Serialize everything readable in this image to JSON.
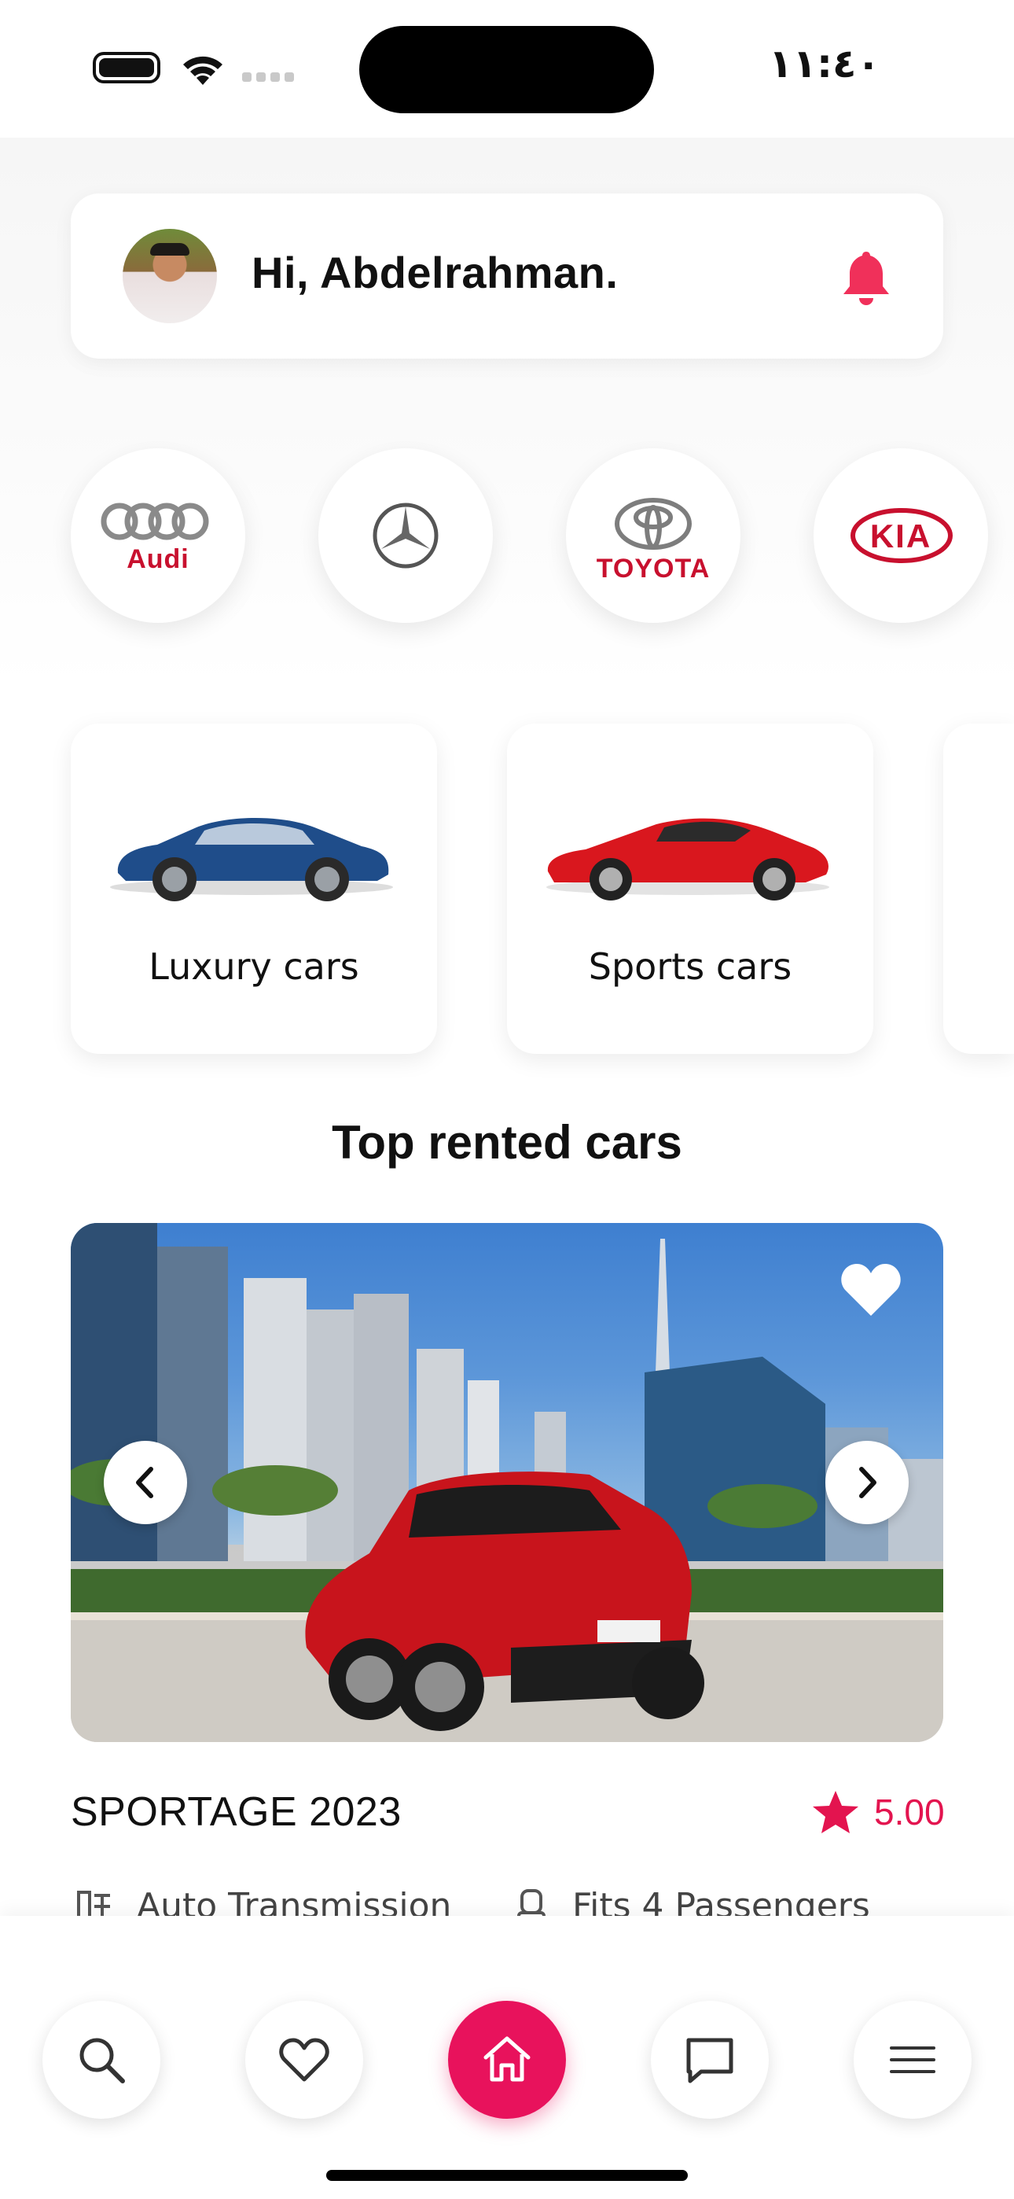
{
  "status_bar": {
    "time": "١١:٤٠"
  },
  "header": {
    "greeting": "Hi, Abdelrahman."
  },
  "brands": [
    {
      "name": "Audi",
      "label": "Audi"
    },
    {
      "name": "Mercedes-Benz",
      "label": ""
    },
    {
      "name": "Toyota",
      "label": "TOYOTA"
    },
    {
      "name": "Kia",
      "label": "KIA"
    }
  ],
  "categories": [
    {
      "label": "Luxury cars"
    },
    {
      "label": "Sports cars"
    }
  ],
  "section": {
    "title": "Top rented cars"
  },
  "featured_car": {
    "name": "SPORTAGE 2023",
    "rating": "5.00",
    "specs": [
      {
        "icon": "gearbox-icon",
        "label": "Auto Transmission"
      },
      {
        "icon": "seat-icon",
        "label": "Fits 4 Passengers"
      }
    ]
  },
  "bottom_nav": [
    {
      "icon": "search-icon"
    },
    {
      "icon": "heart-icon"
    },
    {
      "icon": "home-icon",
      "active": true
    },
    {
      "icon": "chat-icon"
    },
    {
      "icon": "menu-icon"
    }
  ],
  "colors": {
    "accent": "#e8125c",
    "star": "#e3144f",
    "bell": "#f0305a",
    "text": "#111111"
  }
}
